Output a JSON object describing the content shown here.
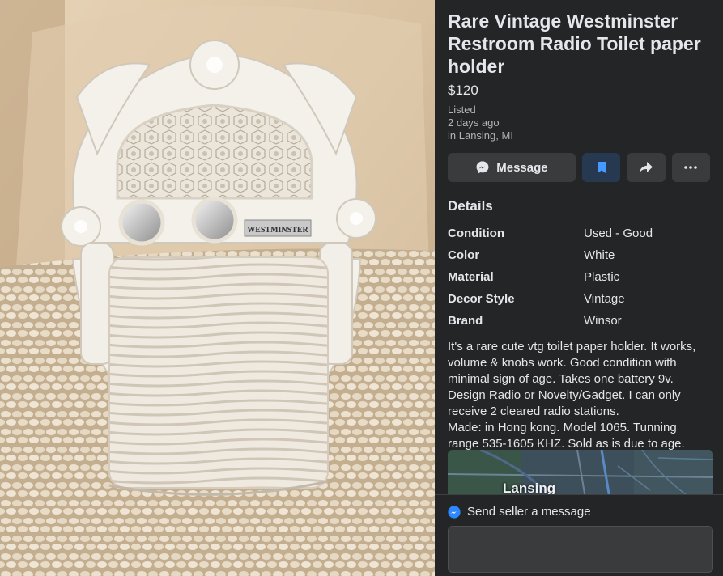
{
  "listing": {
    "title": "Rare Vintage Westminster Restroom Radio Toilet paper holder",
    "price": "$120",
    "listed_label": "Listed",
    "listed_time": "2 days ago",
    "location": "in Lansing, MI"
  },
  "actions": {
    "message_label": "Message"
  },
  "details": {
    "heading": "Details",
    "rows": [
      {
        "key": "Condition",
        "value": "Used - Good"
      },
      {
        "key": "Color",
        "value": "White"
      },
      {
        "key": "Material",
        "value": "Plastic"
      },
      {
        "key": "Decor Style",
        "value": "Vintage"
      },
      {
        "key": "Brand",
        "value": "Winsor"
      }
    ],
    "description": "It's a rare cute vtg toilet paper holder. It works, volume & knobs work. Good condition with minimal sign of age. Takes one battery 9v. Design Radio or Novelty/Gadget. I can only receive 2 cleared radio stations.\nMade: in Hong kong. Model 1065. Tunning range 535-1605 KHZ. Sold as is due to age.  Cash only."
  },
  "map": {
    "city_label": "Lansing"
  },
  "photo": {
    "radio_brand_label": "WESTMINSTER"
  },
  "footer": {
    "send_label": "Send seller a message"
  },
  "colors": {
    "background": "#242526",
    "button": "#3a3b3c",
    "saved_button": "#263951",
    "accent": "#2d88ff"
  }
}
